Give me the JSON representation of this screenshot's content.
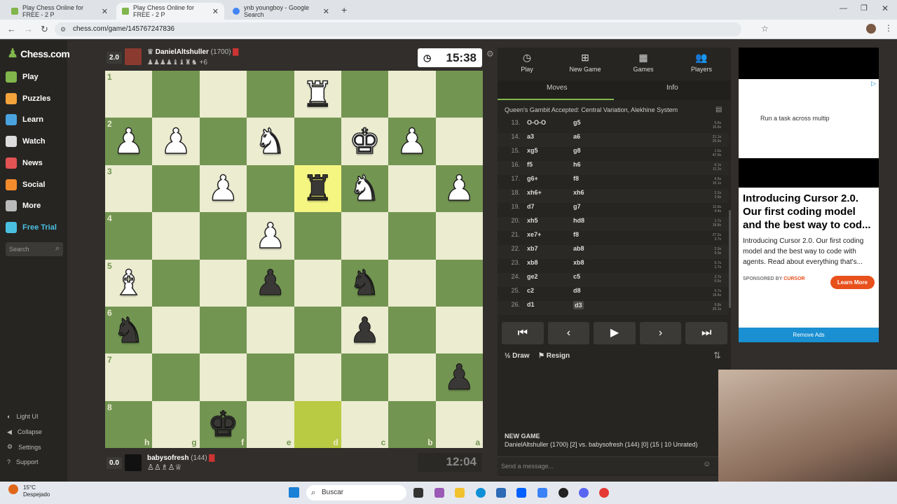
{
  "browser": {
    "tabs": [
      {
        "title": "Play Chess Online for FREE - 2 P",
        "active": false
      },
      {
        "title": "Play Chess Online for FREE - 2 P",
        "active": true
      },
      {
        "title": "ynb youngboy - Google Search",
        "active": false
      }
    ],
    "url": "chess.com/game/145767247836"
  },
  "sidebar": {
    "logo": "Chess.com",
    "items": [
      {
        "label": "Play",
        "icon": "play-pawn-icon"
      },
      {
        "label": "Puzzles",
        "icon": "puzzle-icon"
      },
      {
        "label": "Learn",
        "icon": "learn-icon"
      },
      {
        "label": "Watch",
        "icon": "binoculars-icon"
      },
      {
        "label": "News",
        "icon": "news-icon"
      },
      {
        "label": "Social",
        "icon": "social-icon"
      },
      {
        "label": "More",
        "icon": "more-dots-icon"
      },
      {
        "label": "Free Trial",
        "icon": "diamond-icon"
      }
    ],
    "search_placeholder": "Search",
    "bottom": [
      {
        "label": "Light UI"
      },
      {
        "label": "Collapse"
      },
      {
        "label": "Settings"
      },
      {
        "label": "Support"
      }
    ]
  },
  "top_player": {
    "score": "2.0",
    "name": "DanielAltshuller",
    "rating": "(1700)",
    "extra": "+6",
    "clock": "15:38"
  },
  "bottom_player": {
    "score": "0.0",
    "name": "babysofresh",
    "rating": "(144)",
    "clock": "12:04"
  },
  "board": {
    "rank_labels": [
      "1",
      "2",
      "3",
      "4",
      "5",
      "6",
      "7",
      "8"
    ],
    "file_labels": [
      "h",
      "g",
      "f",
      "e",
      "d",
      "c",
      "b",
      "a"
    ],
    "pieces": [
      {
        "sq": "d1",
        "piece": "♜",
        "color": "w"
      },
      {
        "sq": "h2",
        "piece": "♟",
        "color": "w"
      },
      {
        "sq": "g2",
        "piece": "♟",
        "color": "w"
      },
      {
        "sq": "e2",
        "piece": "♞",
        "color": "w"
      },
      {
        "sq": "c2",
        "piece": "♚",
        "color": "w"
      },
      {
        "sq": "b2",
        "piece": "♟",
        "color": "w"
      },
      {
        "sq": "f3",
        "piece": "♟",
        "color": "w"
      },
      {
        "sq": "d3",
        "piece": "♜",
        "color": "b"
      },
      {
        "sq": "c3",
        "piece": "♞",
        "color": "w"
      },
      {
        "sq": "a3",
        "piece": "♟",
        "color": "w"
      },
      {
        "sq": "e4",
        "piece": "♟",
        "color": "w"
      },
      {
        "sq": "h5",
        "piece": "♝",
        "color": "w"
      },
      {
        "sq": "e5",
        "piece": "♟",
        "color": "b"
      },
      {
        "sq": "c5",
        "piece": "♞",
        "color": "b"
      },
      {
        "sq": "h6",
        "piece": "♞",
        "color": "b"
      },
      {
        "sq": "c6",
        "piece": "♟",
        "color": "b"
      },
      {
        "sq": "a7",
        "piece": "♟",
        "color": "b"
      },
      {
        "sq": "f8",
        "piece": "♚",
        "color": "b"
      }
    ],
    "highlights": [
      {
        "sq": "d3",
        "style": "hl"
      },
      {
        "sq": "d8",
        "style": "hl2"
      }
    ]
  },
  "panel": {
    "tabs": [
      {
        "label": "Play",
        "icon": "stopwatch-icon"
      },
      {
        "label": "New Game",
        "icon": "plus-icon"
      },
      {
        "label": "Games",
        "icon": "board-icon"
      },
      {
        "label": "Players",
        "icon": "players-icon"
      }
    ],
    "subtabs": [
      "Moves",
      "Info"
    ],
    "opening": "Queen's Gambit Accepted: Central Variation, Alekhine System",
    "moves": [
      {
        "n": "13.",
        "w": "O-O-O",
        "b": "g5",
        "tw": "5.6s",
        "tb": "15.6s"
      },
      {
        "n": "14.",
        "w": "a3",
        "b": "a6",
        "tw": "21.1s",
        "tb": "25.4s"
      },
      {
        "n": "15.",
        "w": "xg5",
        "b": "g8",
        "tw": "1.6s",
        "tb": "47.0s"
      },
      {
        "n": "16.",
        "w": "f5",
        "b": "h6",
        "tw": "6.1s",
        "tb": "11.2s"
      },
      {
        "n": "17.",
        "w": "g6+",
        "b": "f8",
        "tw": "6.5s",
        "tb": "15.1s"
      },
      {
        "n": "18.",
        "w": "xh6+",
        "b": "xh6",
        "tw": "2.2s",
        "tb": "2.9s"
      },
      {
        "n": "19.",
        "w": "d7",
        "b": "g7",
        "tw": "12.9s",
        "tb": "4.4s"
      },
      {
        "n": "20.",
        "w": "xh5",
        "b": "hd8",
        "tw": "1.7s",
        "tb": "19.8s"
      },
      {
        "n": "21.",
        "w": "xe7+",
        "b": "f8",
        "tw": "27.2s",
        "tb": "3.7s"
      },
      {
        "n": "22.",
        "w": "xb7",
        "b": "ab8",
        "tw": "2.3s",
        "tb": "5.0s"
      },
      {
        "n": "23.",
        "w": "xb8",
        "b": "xb8",
        "tw": "5.7s",
        "tb": "1.7s"
      },
      {
        "n": "24.",
        "w": "ge2",
        "b": "c5",
        "tw": "2.7s",
        "tb": "6.6s"
      },
      {
        "n": "25.",
        "w": "c2",
        "b": "d8",
        "tw": "5.7s",
        "tb": "19.6s"
      },
      {
        "n": "26.",
        "w": "d1",
        "b": "d3",
        "tw": "5.8s",
        "tb": "20.1s"
      }
    ],
    "controls": [
      "⏮",
      "‹",
      "▶",
      "›",
      "⏭"
    ],
    "draw": "Draw",
    "resign": "Resign",
    "new_game_title": "NEW GAME",
    "new_game_line": "DanielAltshuller (1700) [2] vs. babysofresh (144) [0] (15 | 10 Unrated)",
    "message_placeholder": "Send a message..."
  },
  "ad": {
    "banner_text": "Run a task across multip",
    "title": "Introducing Cursor 2.0. Our first coding model and the best way to cod...",
    "body": "Introducing Cursor 2.0. Our first coding model and the best way to code with agents. Read about everything that's...",
    "sponsor": "SPONSORED BY",
    "sponsor_brand": "CURSOR",
    "cta": "Learn More",
    "remove": "Remove Ads"
  },
  "taskbar": {
    "weather_temp": "15°C",
    "weather_desc": "Despejado",
    "search_placeholder": "Buscar"
  }
}
